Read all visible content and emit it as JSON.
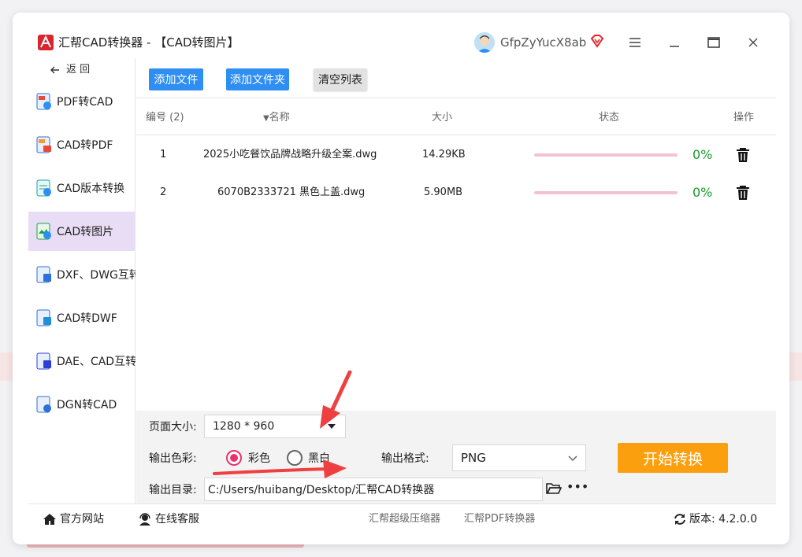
{
  "window": {
    "title": "汇帮CAD转换器 - 【CAD转图片】",
    "username": "GfpZyYucX8ab"
  },
  "sidebar": {
    "back_label": "返 回",
    "items": [
      {
        "label": "PDF转CAD",
        "active": false
      },
      {
        "label": "CAD转PDF",
        "active": false
      },
      {
        "label": "CAD版本转换",
        "active": false
      },
      {
        "label": "CAD转图片",
        "active": true
      },
      {
        "label": "DXF、DWG互转",
        "active": false
      },
      {
        "label": "CAD转DWF",
        "active": false
      },
      {
        "label": "DAE、CAD互转",
        "active": false
      },
      {
        "label": "DGN转CAD",
        "active": false
      }
    ]
  },
  "toolbar": {
    "add_file": "添加文件",
    "add_folder": "添加文件夹",
    "clear_list": "清空列表"
  },
  "table": {
    "headers": {
      "index": "编号 (2)",
      "name": "名称",
      "size": "大小",
      "status": "状态",
      "action": "操作"
    },
    "rows": [
      {
        "index": "1",
        "name": "2025小吃餐饮品牌战略升级全案.dwg",
        "size": "14.29KB",
        "progress": 0,
        "percent": "0%"
      },
      {
        "index": "2",
        "name": "6070B2333721 黑色上盖.dwg",
        "size": "5.90MB",
        "progress": 0,
        "percent": "0%"
      }
    ]
  },
  "settings": {
    "page_size_label": "页面大小:",
    "page_size_value": "1280 * 960",
    "color_label": "输出色彩:",
    "color_option": "彩色",
    "bw_option": "黑白",
    "color_selected": "彩色",
    "format_label": "输出格式:",
    "format_value": "PNG",
    "dir_label": "输出目录:",
    "dir_value": "C:/Users/huibang/Desktop/汇帮CAD转换器",
    "start_button": "开始转换"
  },
  "footer": {
    "website": "官方网站",
    "support": "在线客服",
    "link1": "汇帮超级压缩器",
    "link2": "汇帮PDF转换器",
    "version": "版本: 4.2.0.0"
  },
  "colors": {
    "accent_blue": "#2e8ef2",
    "start_orange": "#fb9f0f",
    "progress_pink": "#f4c2d2",
    "percent_green": "#1a9a2a",
    "radio_pink": "#e8336d",
    "active_nav": "#e9ddf6",
    "annotation_red": "#ee4040"
  },
  "icons": {
    "logo": "cad-app-logo-icon",
    "vip": "diamond-vip-icon",
    "menu": "hamburger-icon",
    "minimize": "minimize-icon",
    "maximize": "maximize-icon",
    "close": "close-icon",
    "delete": "trash-icon",
    "folder": "folder-open-icon",
    "more": "more-icon",
    "home": "home-icon",
    "support": "support-agent-icon",
    "refresh": "refresh-icon"
  }
}
